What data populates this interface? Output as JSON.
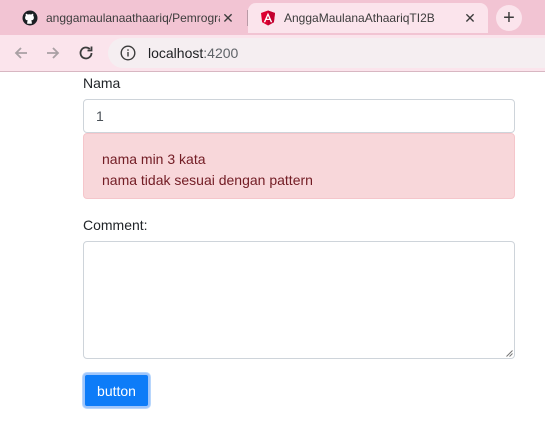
{
  "browser": {
    "tabs": [
      {
        "title": "anggamaulanaathaariq/Pemrogra",
        "icon": "github-icon",
        "active": false
      },
      {
        "title": "AnggaMaulanaAthaariqTI2B",
        "icon": "angular-icon",
        "active": true
      }
    ],
    "new_tab_label": "+",
    "close_label": "✕",
    "url_host": "localhost",
    "url_port": ":4200"
  },
  "form": {
    "nama_label": "Nama",
    "nama_value": "1",
    "errors": [
      "nama min 3 kata",
      "nama tidak sesuai dengan pattern"
    ],
    "comment_label": "Comment:",
    "comment_value": "",
    "button_label": "button"
  },
  "colors": {
    "tabstrip": "#f2c4d3",
    "alert_bg": "#f8d7da",
    "alert_text": "#721c24",
    "button_bg": "#0d7cf8"
  }
}
